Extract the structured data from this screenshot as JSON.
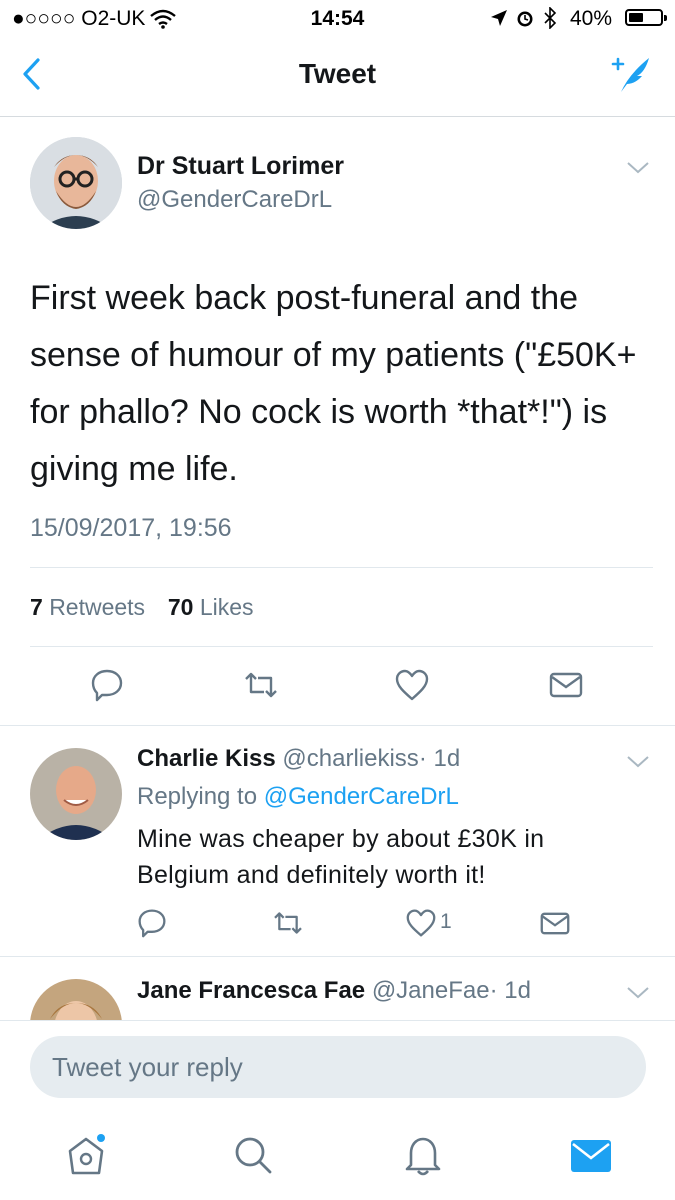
{
  "status_bar": {
    "carrier": "●○○○○ O2-UK",
    "time": "14:54",
    "battery": "40%",
    "battery_level": 0.4
  },
  "nav": {
    "title": "Tweet",
    "back_icon": "chevron-left-icon",
    "compose_icon": "compose-tweet-icon"
  },
  "main_tweet": {
    "author_name": "Dr Stuart Lorimer",
    "author_handle": "@GenderCareDrL",
    "text": "First week back post-funeral and the sense of humour of my patients (\"£50K+ for phallo?  No cock is worth *that*!\") is giving me life.",
    "timestamp": "15/09/2017, 19:56",
    "retweets_count": "7",
    "retweets_label": "Retweets",
    "likes_count": "70",
    "likes_label": "Likes"
  },
  "replies": [
    {
      "name": "Charlie Kiss",
      "handle": "@charliekiss",
      "age": "· 1d",
      "replying_label": "Replying to",
      "replying_to": "@GenderCareDrL",
      "text": "Mine was cheaper by about £30K in Belgium and definitely worth it!",
      "likes": "1"
    },
    {
      "name": "Jane Francesca Fae",
      "handle": "@JaneFae",
      "age": "· 1d"
    }
  ],
  "reply_input": {
    "placeholder": "Tweet your reply"
  },
  "colors": {
    "accent": "#1da1f2",
    "muted": "#657786",
    "divider": "#e1e8ed"
  }
}
